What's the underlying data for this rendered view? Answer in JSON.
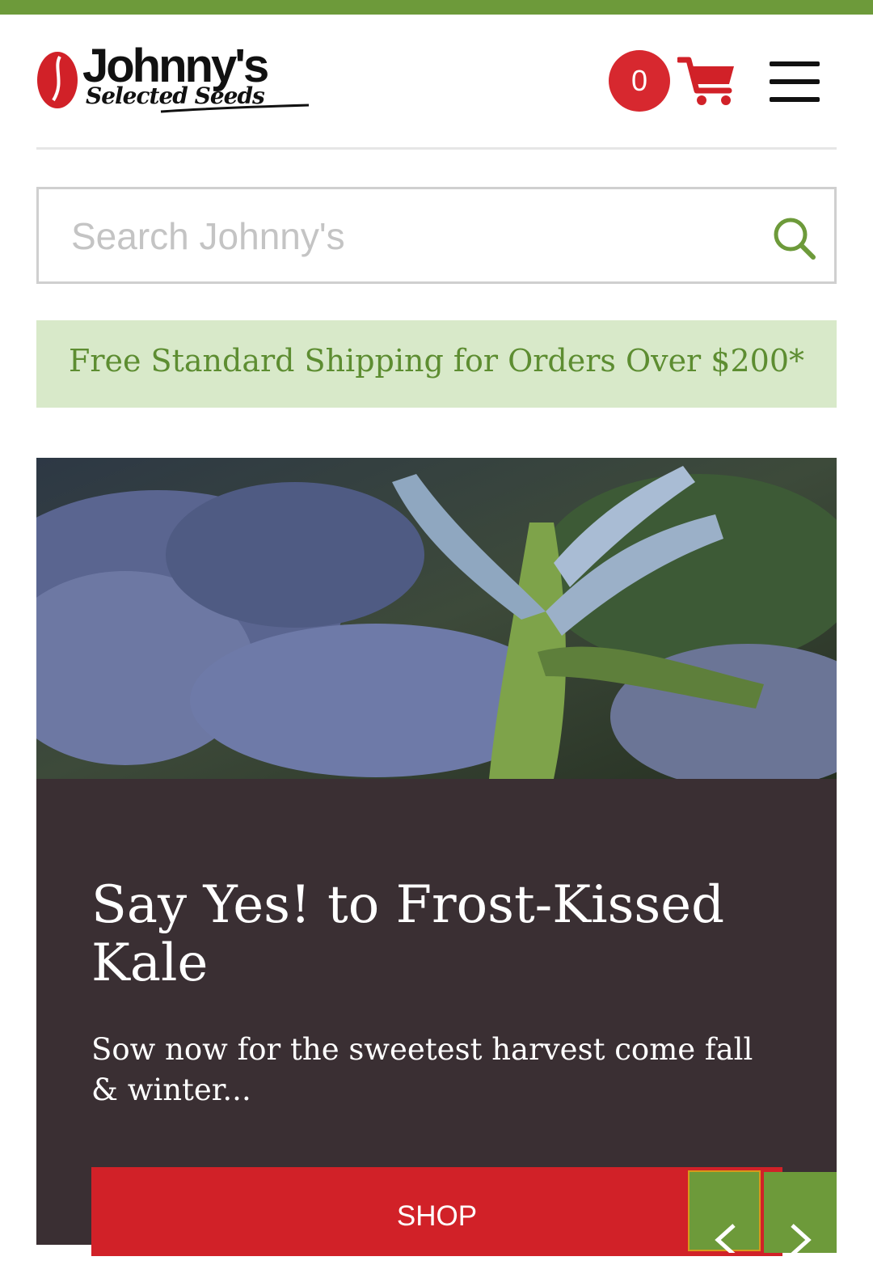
{
  "header": {
    "logo_name": "Johnny's",
    "logo_tagline": "Selected Seeds",
    "cart_count": "0",
    "icons": {
      "cart": "cart-icon",
      "menu": "hamburger-menu-icon",
      "search": "search-icon"
    }
  },
  "search": {
    "placeholder": "Search Johnny's",
    "value": ""
  },
  "shipping_banner": {
    "text": "Free Standard Shipping for Orders Over $200*"
  },
  "hero": {
    "title": "Say Yes! to Frost-Kissed Kale",
    "subtitle": "Sow now for the sweetest harvest come fall & winter...",
    "cta_label": "SHOP"
  },
  "colors": {
    "brand_green": "#6d9a3a",
    "brand_red": "#d12128",
    "banner_bg": "#d8e9c9",
    "banner_text": "#5d8d31",
    "hero_panel": "#3a2f33"
  }
}
